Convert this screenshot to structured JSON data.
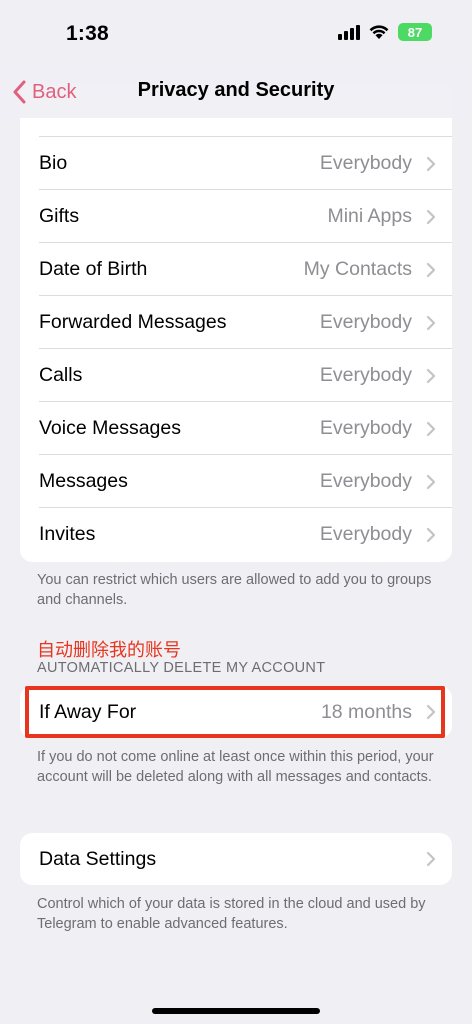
{
  "status_bar": {
    "time": "1:38",
    "battery": "87"
  },
  "nav": {
    "back_label": "Back",
    "title": "Privacy and Security"
  },
  "privacy_rows": [
    {
      "label": "Bio",
      "value": "Everybody"
    },
    {
      "label": "Gifts",
      "value": "Mini Apps"
    },
    {
      "label": "Date of Birth",
      "value": "My Contacts"
    },
    {
      "label": "Forwarded Messages",
      "value": "Everybody"
    },
    {
      "label": "Calls",
      "value": "Everybody"
    },
    {
      "label": "Voice Messages",
      "value": "Everybody"
    },
    {
      "label": "Messages",
      "value": "Everybody"
    },
    {
      "label": "Invites",
      "value": "Everybody"
    }
  ],
  "invites_note": "You can restrict which users are allowed to add you to groups and channels.",
  "annotation_text": "自动删除我的账号",
  "auto_delete": {
    "header": "AUTOMATICALLY DELETE MY ACCOUNT",
    "row_label": "If Away For",
    "row_value": "18 months",
    "note": "If you do not come online at least once within this period, your account will be deleted along with all messages and contacts."
  },
  "data_settings": {
    "label": "Data Settings",
    "note": "Control which of your data is stored in the cloud and used by Telegram to enable advanced features."
  },
  "colors": {
    "accent": "#e0607e",
    "annotation": "#e8351e",
    "battery": "#4cd964"
  }
}
